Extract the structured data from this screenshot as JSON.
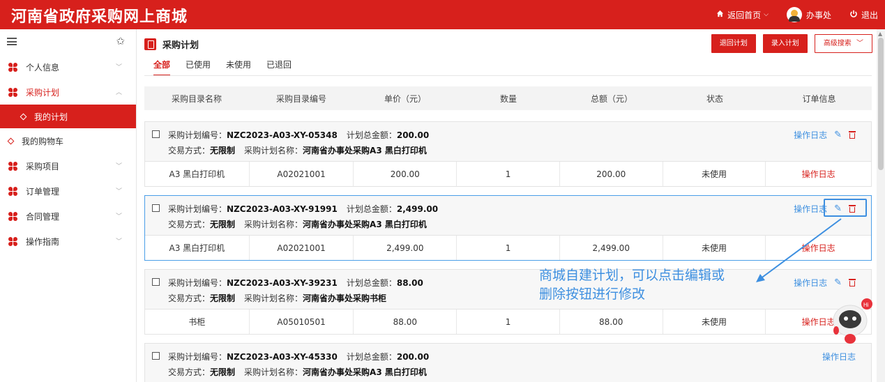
{
  "header": {
    "title": "河南省政府采购网上商城",
    "nav": [
      {
        "label": "返回首页",
        "icon": "home-icon"
      },
      {
        "label": "办事处",
        "icon": "avatar"
      },
      {
        "label": "退出",
        "icon": "power-icon"
      }
    ]
  },
  "colors": {
    "brand": "#d7201c",
    "link": "#3d8fe0"
  },
  "sidebar": {
    "items": [
      {
        "label": "个人信息"
      },
      {
        "label": "采购计划"
      },
      {
        "label": "我的计划"
      },
      {
        "label": "我的购物车"
      },
      {
        "label": "采购项目"
      },
      {
        "label": "订单管理"
      },
      {
        "label": "合同管理"
      },
      {
        "label": "操作指南"
      }
    ]
  },
  "page": {
    "title": "采购计划",
    "buttons": {
      "back": "退回计划",
      "entry": "录入计划",
      "advanced": "高级搜索"
    },
    "tabs": [
      "全部",
      "已使用",
      "未使用",
      "已退回"
    ]
  },
  "table": {
    "headers": [
      "采购目录名称",
      "采购目录编号",
      "单价（元）",
      "数量",
      "总额（元）",
      "状态",
      "订单信息"
    ],
    "labels": {
      "plan_no": "采购计划编号：",
      "total": "计划总金额：",
      "trade": "交易方式：",
      "plan_name": "采购计划名称："
    },
    "groups": [
      {
        "plan_no": "NZC2023-A03-XY-05348",
        "total": "200.00",
        "trade": "无限制",
        "plan_name": "河南省办事处采购A3 黑白打印机",
        "log": "操作日志",
        "row": {
          "name": "A3 黑白打印机",
          "code": "A02021001",
          "price": "200.00",
          "qty": "1",
          "amount": "200.00",
          "status": "未使用",
          "order": "操作日志"
        }
      },
      {
        "plan_no": "NZC2023-A03-XY-91991",
        "total": "2,499.00",
        "trade": "无限制",
        "plan_name": "河南省办事处采购A3 黑白打印机",
        "log": "操作日志",
        "row": {
          "name": "A3 黑白打印机",
          "code": "A02021001",
          "price": "2,499.00",
          "qty": "1",
          "amount": "2,499.00",
          "status": "未使用",
          "order": "操作日志"
        }
      },
      {
        "plan_no": "NZC2023-A03-XY-39231",
        "total": "88.00",
        "trade": "无限制",
        "plan_name": "河南省办事处采购书柜",
        "log": "操作日志",
        "row": {
          "name": "书柜",
          "code": "A05010501",
          "price": "88.00",
          "qty": "1",
          "amount": "88.00",
          "status": "未使用",
          "order": "操作日志"
        }
      },
      {
        "plan_no": "NZC2023-A03-XY-45330",
        "total": "200.00",
        "trade": "无限制",
        "plan_name": "河南省办事处采购A3 黑白打印机",
        "log": "操作日志"
      }
    ]
  },
  "annotation": {
    "line1": "商城自建计划，可以点击编辑或",
    "line2": "删除按钮进行修改"
  }
}
